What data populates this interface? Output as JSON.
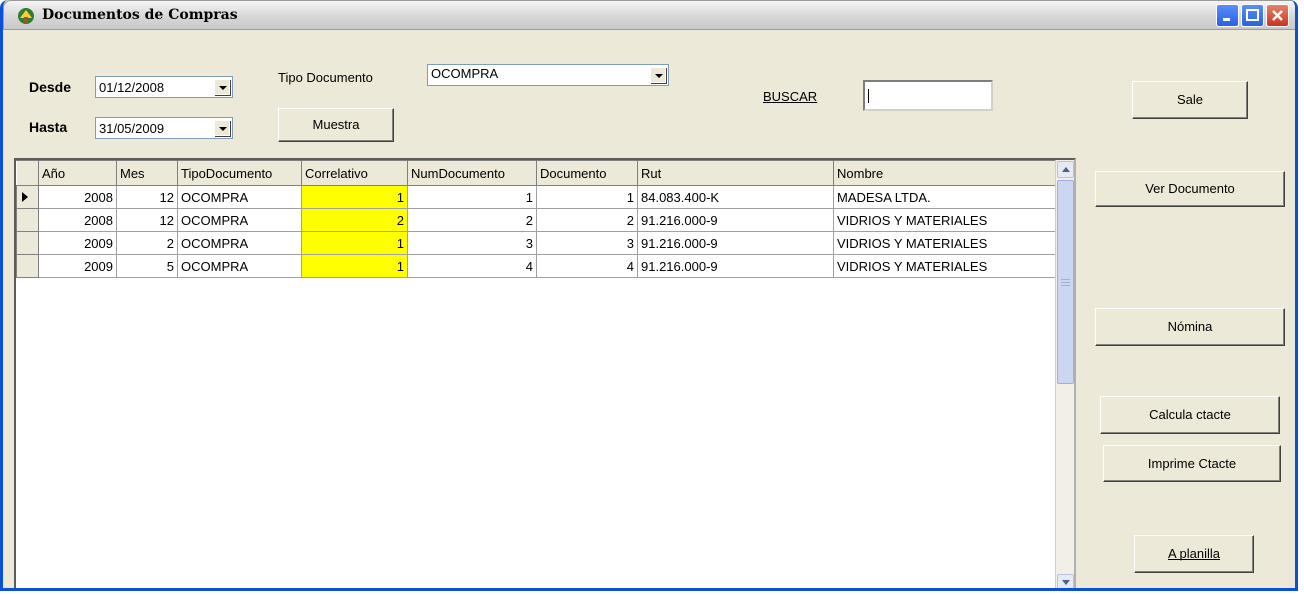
{
  "window": {
    "title": "Documentos de Compras"
  },
  "filters": {
    "desde_label": "Desde",
    "desde_value": "01/12/2008",
    "hasta_label": "Hasta",
    "hasta_value": "31/05/2009",
    "tipo_label": "Tipo Documento",
    "tipo_value": "OCOMPRA",
    "muestra_label": "Muestra",
    "buscar_label": "BUSCAR",
    "buscar_value": "",
    "sale_label": "Sale"
  },
  "grid": {
    "columns": [
      "Año",
      "Mes",
      "TipoDocumento",
      "Correlativo",
      "NumDocumento",
      "Documento",
      "Rut",
      "Nombre"
    ],
    "rows": [
      [
        "2008",
        "12",
        "OCOMPRA",
        "1",
        "1",
        "1",
        "84.083.400-K",
        "MADESA LTDA."
      ],
      [
        "2008",
        "12",
        "OCOMPRA",
        "2",
        "2",
        "2",
        "91.216.000-9",
        "VIDRIOS Y MATERIALES"
      ],
      [
        "2009",
        "2",
        "OCOMPRA",
        "1",
        "3",
        "3",
        "91.216.000-9",
        "VIDRIOS Y MATERIALES"
      ],
      [
        "2009",
        "5",
        "OCOMPRA",
        "1",
        "4",
        "4",
        "91.216.000-9",
        "VIDRIOS Y MATERIALES"
      ]
    ],
    "highlight_color": "#ffff00"
  },
  "actions": {
    "ver_documento": "Ver Documento",
    "nomina": "Nómina",
    "calcula_ctacte": "Calcula ctacte",
    "imprime_ctacte": "Imprime Ctacte",
    "a_planilla": "A planilla"
  },
  "colors": {
    "titlebar_border": "#0a50d8",
    "window_bg": "#ece9d8",
    "close_button": "#c6361e"
  }
}
